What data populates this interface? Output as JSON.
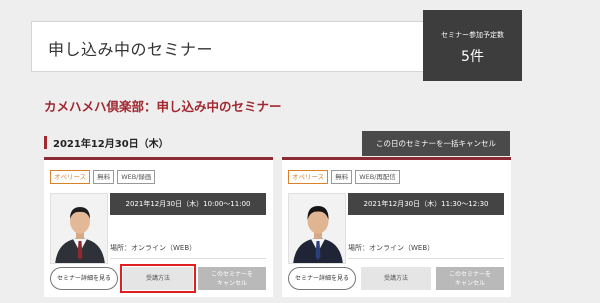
{
  "header": {
    "title": "申し込み中のセミナー",
    "count_label": "セミナー参加予定数",
    "count_value": "5件"
  },
  "section": {
    "club_title": "カメハメハ倶楽部：申し込み中のセミナー",
    "date": "2021年12月30日（木）",
    "cancel_all_label": "この日のセミナーを一括キャンセル"
  },
  "cards": [
    {
      "tags": [
        "オペリース",
        "無料",
        "WEB/録画"
      ],
      "datetime": "2021年12月30日（木）10:00～11:00",
      "place": "場所：オンライン（WEB）",
      "detail_label": "セミナー詳細を見る",
      "howto_label": "受講方法",
      "cancel_label_1": "このセミナーを",
      "cancel_label_2": "キャンセル"
    },
    {
      "tags": [
        "オペリース",
        "無料",
        "WEB/再配信"
      ],
      "datetime": "2021年12月30日（木）11:30～12:30",
      "place": "場所：オンライン（WEB）",
      "detail_label": "セミナー詳細を見る",
      "howto_label": "受講方法",
      "cancel_label_1": "このセミナーを",
      "cancel_label_2": "キャンセル"
    }
  ],
  "colors": {
    "accent": "#a02830",
    "card_top": "#8b2a32",
    "tag_orange": "#d9822b",
    "highlight": "#e02020"
  }
}
